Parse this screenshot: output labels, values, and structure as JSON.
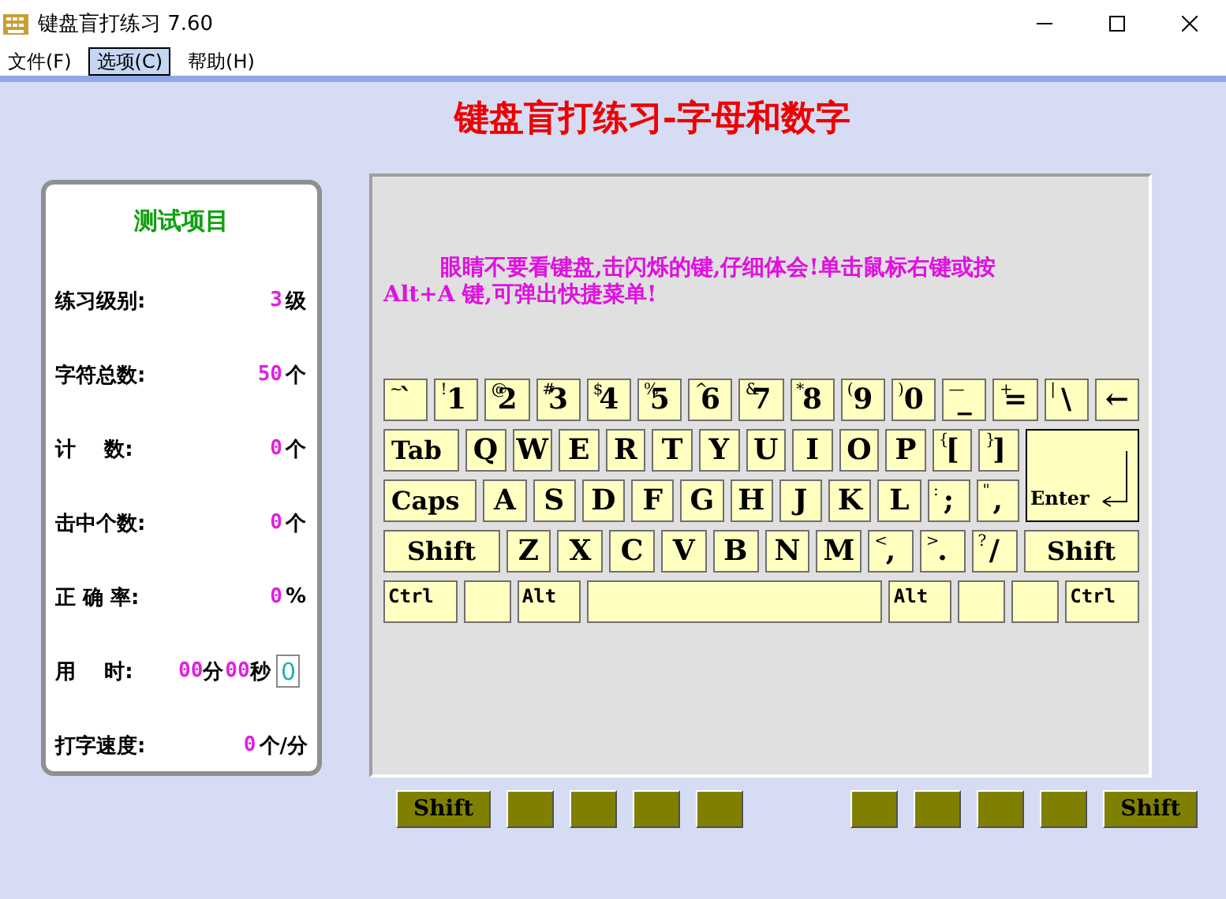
{
  "window": {
    "title": "键盘盲打练习 7.60"
  },
  "menu": [
    {
      "label": "文件(F)",
      "selected": false
    },
    {
      "label": "选项(C)",
      "selected": true
    },
    {
      "label": "帮助(H)",
      "selected": false
    }
  ],
  "heading": "键盘盲打练习-字母和数字",
  "stats": {
    "title": "测试项目",
    "rows": [
      {
        "kind": "stat",
        "label": "练习级别:",
        "value": "3",
        "unit": "级"
      },
      {
        "kind": "stat",
        "label": "字符总数:",
        "value": "50",
        "unit": "个"
      },
      {
        "kind": "stat",
        "label": "计    数:",
        "value": "0",
        "unit": "个"
      },
      {
        "kind": "stat",
        "label": "击中个数:",
        "value": "0",
        "unit": "个"
      },
      {
        "kind": "stat",
        "label": "正 确 率:",
        "value": "0",
        "unit": "%"
      },
      {
        "kind": "time",
        "label": "用    时:",
        "minutes": "00",
        "minutes_unit": "分",
        "seconds": "00",
        "seconds_unit": "秒",
        "counter": "0"
      },
      {
        "kind": "stat",
        "label": "打字速度:",
        "value": "0",
        "unit": "个/分"
      }
    ]
  },
  "message": "眼睛不要看键盘,击闪烁的键,仔细体会!单击鼠标右键或按 Alt+A 键,可弹出快捷菜单!",
  "keyboard": {
    "rows": [
      {
        "keys": [
          {
            "kind": "char",
            "upper": "~",
            "lower": "`"
          },
          {
            "kind": "char",
            "upper": "!",
            "lower": "1"
          },
          {
            "kind": "char",
            "upper": "@",
            "lower": "2"
          },
          {
            "kind": "char",
            "upper": "#",
            "lower": "3"
          },
          {
            "kind": "char",
            "upper": "$",
            "lower": "4"
          },
          {
            "kind": "char",
            "upper": "%",
            "lower": "5"
          },
          {
            "kind": "char",
            "upper": "^",
            "lower": "6"
          },
          {
            "kind": "char",
            "upper": "&",
            "lower": "7"
          },
          {
            "kind": "char",
            "upper": "*",
            "lower": "8"
          },
          {
            "kind": "char",
            "upper": "(",
            "lower": "9"
          },
          {
            "kind": "char",
            "upper": ")",
            "lower": "0"
          },
          {
            "kind": "char",
            "upper": "—",
            "lower": "_"
          },
          {
            "kind": "char",
            "upper": "+",
            "lower": "="
          },
          {
            "kind": "char",
            "upper": "|",
            "lower": "\\"
          },
          {
            "kind": "char",
            "lower": "←"
          }
        ]
      },
      {
        "keys": [
          {
            "kind": "word",
            "label": "Tab"
          },
          {
            "kind": "char",
            "lower": "Q"
          },
          {
            "kind": "char",
            "lower": "W"
          },
          {
            "kind": "char",
            "lower": "E"
          },
          {
            "kind": "char",
            "lower": "R"
          },
          {
            "kind": "char",
            "lower": "T"
          },
          {
            "kind": "char",
            "lower": "Y"
          },
          {
            "kind": "char",
            "lower": "U"
          },
          {
            "kind": "char",
            "lower": "I"
          },
          {
            "kind": "char",
            "lower": "O"
          },
          {
            "kind": "char",
            "lower": "P"
          },
          {
            "kind": "char",
            "upper": "{",
            "lower": "["
          },
          {
            "kind": "char",
            "upper": "}",
            "lower": "]"
          }
        ]
      },
      {
        "keys": [
          {
            "kind": "word",
            "label": "Caps"
          },
          {
            "kind": "char",
            "lower": "A"
          },
          {
            "kind": "char",
            "lower": "S"
          },
          {
            "kind": "char",
            "lower": "D"
          },
          {
            "kind": "char",
            "lower": "F"
          },
          {
            "kind": "char",
            "lower": "G"
          },
          {
            "kind": "char",
            "lower": "H"
          },
          {
            "kind": "char",
            "lower": "J"
          },
          {
            "kind": "char",
            "lower": "K"
          },
          {
            "kind": "char",
            "lower": "L"
          },
          {
            "kind": "char",
            "upper": ":",
            "lower": ";"
          },
          {
            "kind": "char",
            "upper": "\"",
            "lower": ","
          }
        ]
      },
      {
        "keys": [
          {
            "kind": "word",
            "label": "Shift"
          },
          {
            "kind": "char",
            "lower": "Z"
          },
          {
            "kind": "char",
            "lower": "X"
          },
          {
            "kind": "char",
            "lower": "C"
          },
          {
            "kind": "char",
            "lower": "V"
          },
          {
            "kind": "char",
            "lower": "B"
          },
          {
            "kind": "char",
            "lower": "N"
          },
          {
            "kind": "char",
            "lower": "M"
          },
          {
            "kind": "char",
            "upper": "<",
            "lower": ","
          },
          {
            "kind": "char",
            "upper": ">",
            "lower": "."
          },
          {
            "kind": "char",
            "upper": "?",
            "lower": "/"
          },
          {
            "kind": "word",
            "label": "Shift"
          }
        ]
      },
      {
        "keys": [
          {
            "kind": "small",
            "label": "Ctrl"
          },
          {
            "kind": "blank"
          },
          {
            "kind": "small",
            "label": "Alt"
          },
          {
            "kind": "space"
          },
          {
            "kind": "small",
            "label": "Alt"
          },
          {
            "kind": "blank"
          },
          {
            "kind": "blank"
          },
          {
            "kind": "small",
            "label": "Ctrl"
          }
        ]
      }
    ],
    "enter": "Enter"
  },
  "finger_keys": {
    "left": [
      {
        "kind": "labeled",
        "label": "Shift"
      },
      {
        "kind": "blank"
      },
      {
        "kind": "blank"
      },
      {
        "kind": "blank"
      },
      {
        "kind": "blank"
      }
    ],
    "right": [
      {
        "kind": "blank"
      },
      {
        "kind": "blank"
      },
      {
        "kind": "blank"
      },
      {
        "kind": "blank"
      },
      {
        "kind": "labeled",
        "label": "Shift"
      }
    ]
  }
}
